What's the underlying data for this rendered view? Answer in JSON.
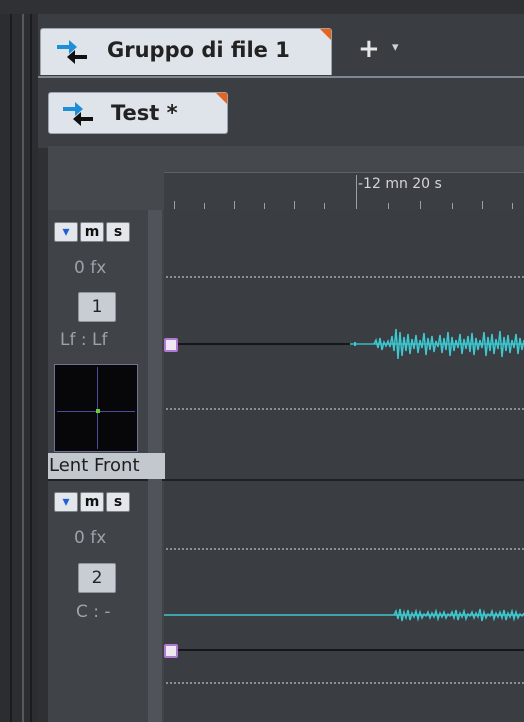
{
  "tabs": {
    "main": {
      "label": "Gruppo di file 1"
    },
    "add": {
      "plus": "+",
      "caret": "▾"
    },
    "project": {
      "label": "Test *"
    }
  },
  "ruler": {
    "time_label": "-12 mn 20 s"
  },
  "tracks": [
    {
      "buttons": [
        "▾",
        "m",
        "s"
      ],
      "fx": "0 fx",
      "number": "1",
      "channel": "Lf : Lf",
      "pan_label": "Lent Front"
    },
    {
      "buttons": [
        "▾",
        "m",
        "s"
      ],
      "fx": "0 fx",
      "number": "2",
      "channel": "C : -"
    }
  ],
  "colors": {
    "accent_orange": "#e8641c",
    "waveform": "#3ec7cf",
    "handle": "#b07ad0",
    "panner_dot": "#5fd13c"
  }
}
